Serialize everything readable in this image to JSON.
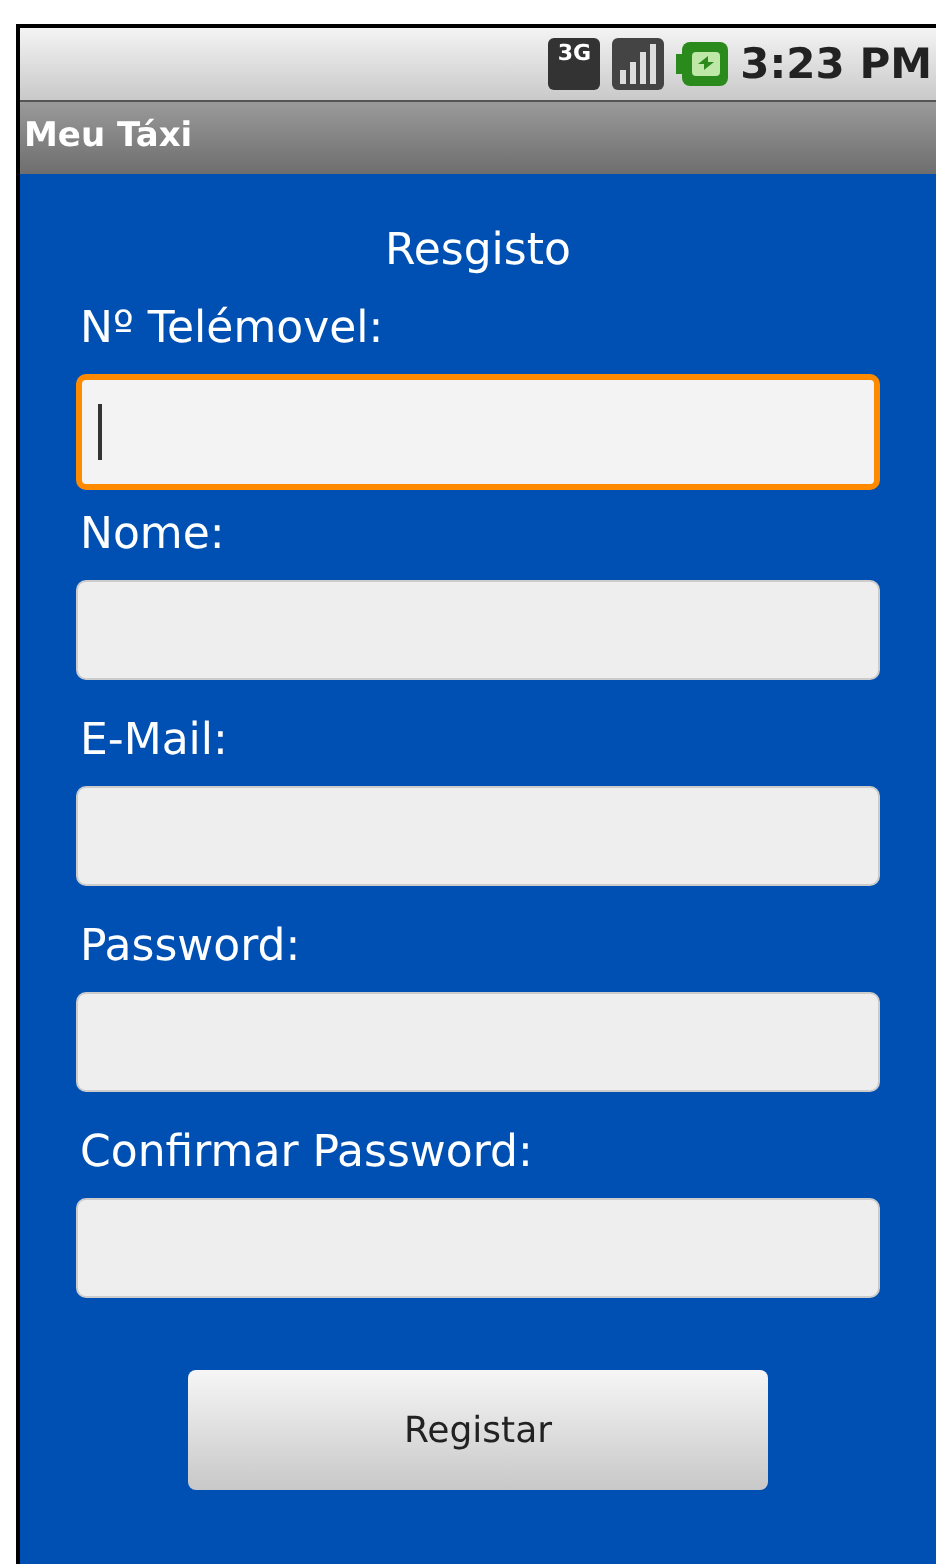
{
  "status_bar": {
    "time": "3:23 PM",
    "network": "3G"
  },
  "title_bar": {
    "title": "Meu Táxi"
  },
  "form": {
    "heading": "Resgisto",
    "fields": [
      {
        "label": "Nº Telémovel:",
        "focused": true
      },
      {
        "label": "Nome:",
        "focused": false
      },
      {
        "label": "E-Mail:",
        "focused": false
      },
      {
        "label": "Password:",
        "focused": false
      },
      {
        "label": "Confirmar Password:",
        "focused": false
      }
    ],
    "submit": "Registar"
  }
}
